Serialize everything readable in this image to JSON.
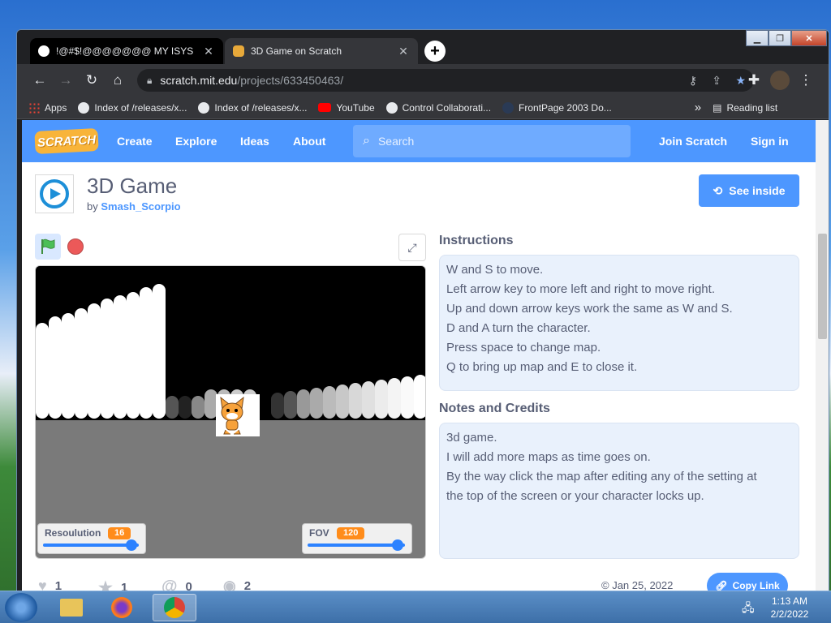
{
  "browser": {
    "tabs": [
      {
        "title": "!@#$!@@@@@@@ MY ISYS PR",
        "active": true
      },
      {
        "title": "3D Game on Scratch",
        "active": false
      }
    ],
    "url_host": "scratch.mit.edu",
    "url_path": "/projects/633450463/",
    "bookmarks": [
      {
        "label": "Apps",
        "icon": "apps-grid-icon"
      },
      {
        "label": "Index of /releases/x...",
        "icon": "globe-icon"
      },
      {
        "label": "Index of /releases/x...",
        "icon": "globe-icon"
      },
      {
        "label": "YouTube",
        "icon": "youtube-icon"
      },
      {
        "label": "Control Collaborati...",
        "icon": "globe-icon"
      },
      {
        "label": "FrontPage 2003 Do...",
        "icon": "frontpage-icon"
      }
    ],
    "reading_list": "Reading list",
    "overflow": "»"
  },
  "scratch": {
    "logo": "SCRATCH",
    "nav": [
      "Create",
      "Explore",
      "Ideas",
      "About"
    ],
    "search_placeholder": "Search",
    "join": "Join Scratch",
    "signin": "Sign in"
  },
  "project": {
    "title": "3D Game",
    "by": "by",
    "author": "Smash_Scorpio",
    "see_inside": "See inside",
    "monitors": [
      {
        "label": "Resoulution",
        "value": "16",
        "slider": 1.0
      },
      {
        "label": "FOV",
        "value": "120",
        "slider": 1.0
      }
    ],
    "instructions_heading": "Instructions",
    "instructions": [
      "W and S to move.",
      "Left arrow key to more left and right to move right.",
      "Up and down arrow keys work the same as W and S.",
      "D and A turn the character.",
      "Press space to change map.",
      "Q to bring up map and E to close it."
    ],
    "notes_heading": "Notes and Credits",
    "notes": [
      "3d game.",
      "I will add more maps as time goes on.",
      "By the way click the map after editing any of the setting at",
      "the top of the screen or your character locks up."
    ],
    "stats": {
      "loves": "1",
      "favorites": "1",
      "remixes": "0",
      "views": "2"
    },
    "date": "© Jan 25, 2022",
    "copy_link": "Copy Link"
  },
  "taskbar": {
    "time": "1:13 AM",
    "date": "2/2/2022"
  },
  "colors": {
    "scratch_blue": "#4d97ff",
    "orange": "#ff8c1a"
  }
}
